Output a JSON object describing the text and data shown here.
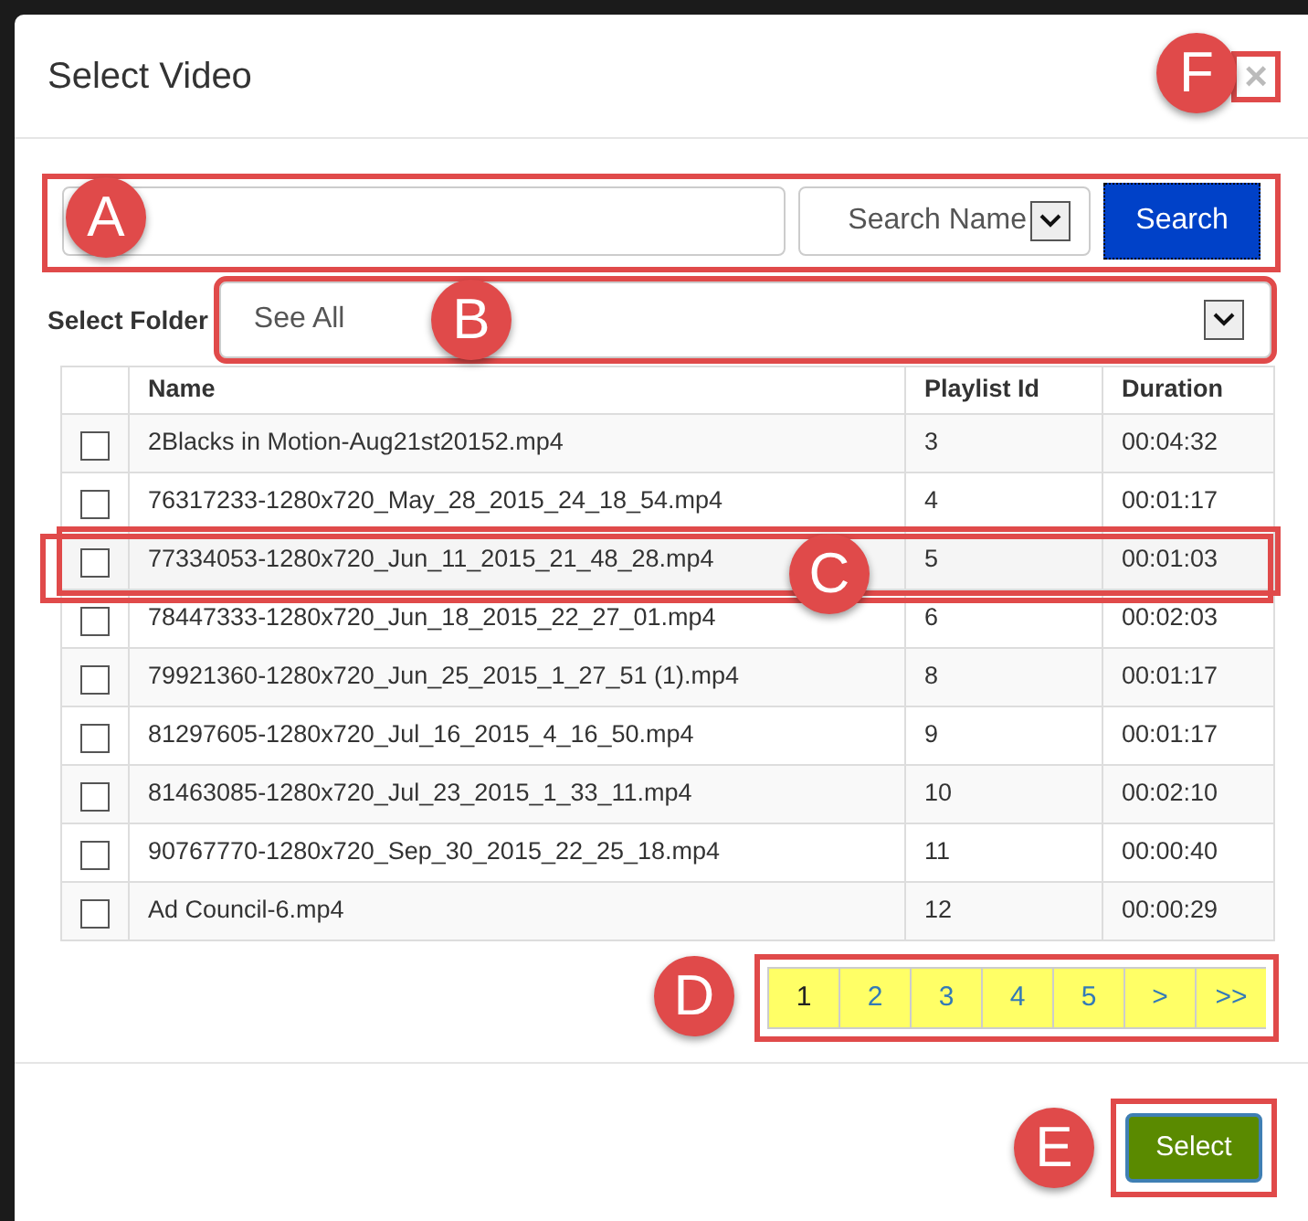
{
  "dialog": {
    "title": "Select Video",
    "close": "×",
    "callout": "F",
    "highlighted": true
  },
  "search": {
    "scope": "Search Name",
    "button": "Search",
    "callout": "A",
    "highlighted": true
  },
  "folder": {
    "label": "Select Folder",
    "value": "See All",
    "callout": "B",
    "highlighted": true
  },
  "table": {
    "columns": [
      "Name",
      "Playlist Id",
      "Duration"
    ],
    "rows": [
      {
        "checked": false,
        "highlighted": false,
        "name": "2Blacks in Motion-Aug21st20152.mp4",
        "playlist_id": "3",
        "duration": "00:04:32"
      },
      {
        "checked": false,
        "highlighted": false,
        "name": "76317233-1280x720_May_28_2015_24_18_54.mp4",
        "playlist_id": "4",
        "duration": "00:01:17"
      },
      {
        "checked": false,
        "highlighted": true,
        "callout": "C",
        "name": "77334053-1280x720_Jun_11_2015_21_48_28.mp4",
        "playlist_id": "5",
        "duration": "00:01:03"
      },
      {
        "checked": false,
        "highlighted": false,
        "name": "78447333-1280x720_Jun_18_2015_22_27_01.mp4",
        "playlist_id": "6",
        "duration": "00:02:03"
      },
      {
        "checked": false,
        "highlighted": false,
        "name": "79921360-1280x720_Jun_25_2015_1_27_51 (1).mp4",
        "playlist_id": "8",
        "duration": "00:01:17"
      },
      {
        "checked": false,
        "highlighted": false,
        "name": "81297605-1280x720_Jul_16_2015_4_16_50.mp4",
        "playlist_id": "9",
        "duration": "00:01:17"
      },
      {
        "checked": false,
        "highlighted": false,
        "name": "81463085-1280x720_Jul_23_2015_1_33_11.mp4",
        "playlist_id": "10",
        "duration": "00:02:10"
      },
      {
        "checked": false,
        "highlighted": false,
        "name": "90767770-1280x720_Sep_30_2015_22_25_18.mp4",
        "playlist_id": "11",
        "duration": "00:00:40"
      },
      {
        "checked": false,
        "highlighted": false,
        "name": "Ad Council-6.mp4",
        "playlist_id": "12",
        "duration": "00:00:29"
      }
    ]
  },
  "pagination": {
    "callout": "D",
    "highlighted": true,
    "pages": [
      {
        "label": "1",
        "selected": true
      },
      {
        "label": "2",
        "selected": false
      },
      {
        "label": "3",
        "selected": false
      },
      {
        "label": "4",
        "selected": false
      },
      {
        "label": "5",
        "selected": false
      },
      {
        "label": ">",
        "selected": false
      },
      {
        "label": ">>",
        "selected": false
      }
    ]
  },
  "footer": {
    "button": "Select",
    "callout": "E",
    "highlighted": true
  }
}
